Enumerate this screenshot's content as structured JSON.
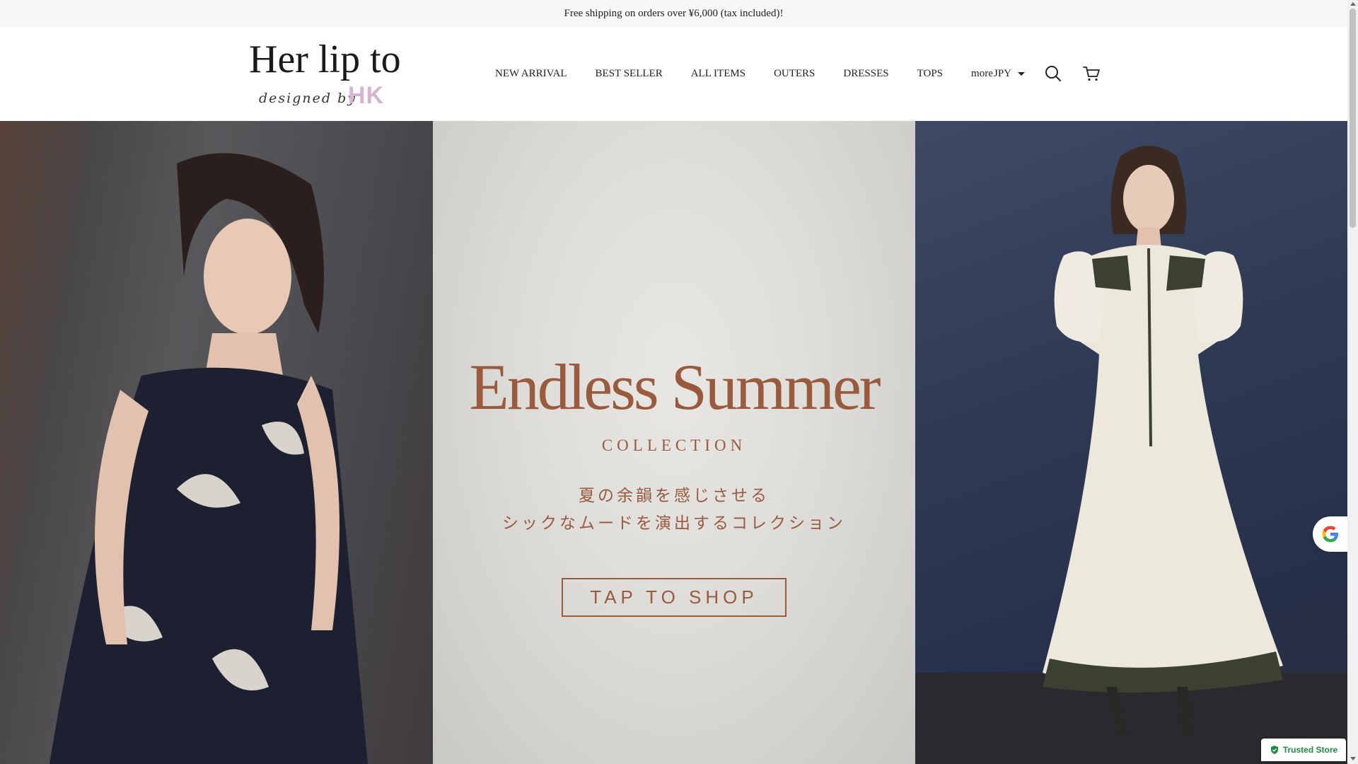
{
  "announcement": {
    "text": "Free shipping on orders over ¥6,000 (tax included)!"
  },
  "logo": {
    "name": "Her lip to",
    "tagline": "designed by",
    "initials": "HK"
  },
  "nav": {
    "items": [
      {
        "label": "NEW ARRIVAL"
      },
      {
        "label": "BEST SELLER"
      },
      {
        "label": "ALL ITEMS"
      },
      {
        "label": "OUTERS"
      },
      {
        "label": "DRESSES"
      },
      {
        "label": "TOPS"
      },
      {
        "label": "more"
      }
    ]
  },
  "currency": {
    "selected": "JPY"
  },
  "icons": {
    "search": "search-icon",
    "cart": "cart-icon",
    "caret": "chevron-down-icon"
  },
  "hero": {
    "title": "Endless Summer",
    "subtitle": "COLLECTION",
    "jp_line1": "夏の余韻を感じさせる",
    "jp_line2": "シックなムードを演出するコレクション",
    "cta_label": "TAP TO SHOP"
  },
  "badges": {
    "trusted_label": "Trusted Store"
  },
  "colors": {
    "accent": "#9a5a3e",
    "logo_hk": "#d8b3d0",
    "trusted_green": "#1e8e3e"
  }
}
